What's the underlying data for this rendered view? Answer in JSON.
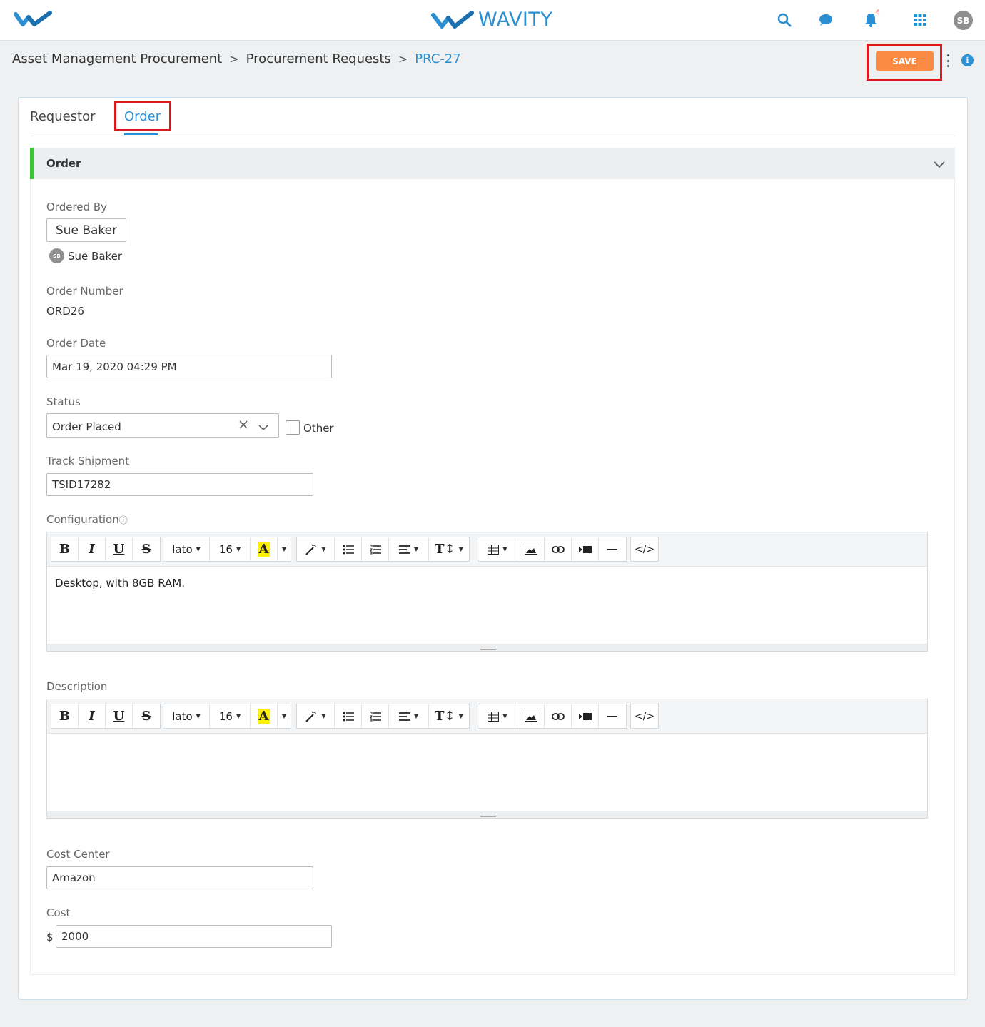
{
  "header": {
    "brand": "WAVITY",
    "notification_count": "6",
    "user_initials": "SB",
    "icons": [
      "search-icon",
      "chat-icon",
      "bell-icon",
      "apps-grid-icon"
    ]
  },
  "breadcrumb": {
    "items": [
      "Asset Management Procurement",
      "Procurement Requests",
      "PRC-27"
    ],
    "separator": ">"
  },
  "actions": {
    "save_label": "SAVE"
  },
  "tabs": [
    {
      "label": "Requestor",
      "active": false
    },
    {
      "label": "Order",
      "active": true
    }
  ],
  "section": {
    "title": "Order"
  },
  "fields": {
    "ordered_by": {
      "label": "Ordered By",
      "value": "Sue Baker",
      "user_name": "Sue Baker",
      "user_initials": "SB"
    },
    "order_number": {
      "label": "Order Number",
      "value": "ORD26"
    },
    "order_date": {
      "label": "Order Date",
      "value": "Mar 19, 2020 04:29 PM"
    },
    "status": {
      "label": "Status",
      "value": "Order Placed",
      "other_label": "Other",
      "other_checked": false
    },
    "track_shipment": {
      "label": "Track Shipment",
      "value": "TSID17282"
    },
    "configuration": {
      "label": "Configuration",
      "content": "Desktop, with 8GB RAM."
    },
    "description": {
      "label": "Description",
      "content": ""
    },
    "cost_center": {
      "label": "Cost Center",
      "value": "Amazon"
    },
    "cost": {
      "label": "Cost",
      "currency": "$",
      "value": "2000"
    }
  },
  "editor_toolbar": {
    "bold": "B",
    "italic": "I",
    "underline": "U",
    "strike": "S",
    "font": "lato",
    "size": "16",
    "color": "A",
    "code": "</>"
  },
  "colors": {
    "accent": "#2b8fd1",
    "save": "#fb8a43",
    "section_marker": "#3ec33c",
    "highlight": "#e0171d"
  }
}
